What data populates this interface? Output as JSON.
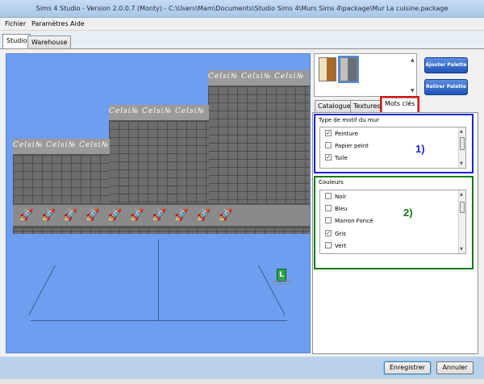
{
  "window": {
    "title": "Sims 4 Studio - Version 2.0.0.7  (Monty)   - C:\\Users\\Mam\\Documents\\Studio Sims 4\\Murs Sims 4\\package\\Mur  La cuisine.package"
  },
  "menu": {
    "items": [
      "Fichier",
      "Paramètres",
      "Aide"
    ]
  },
  "main_tabs": [
    {
      "label": "Studio",
      "active": true
    },
    {
      "label": "Warehouse",
      "active": false
    }
  ],
  "viewport": {
    "wall_signature": "Celsi№",
    "frieze_motif": "🚀",
    "lot_label": "L"
  },
  "palette": {
    "add_label": "Ajouter Palette",
    "remove_label": "Retirer Palette",
    "swatches": [
      {
        "name": "brown-swatch",
        "color": "#a76a2a"
      },
      {
        "name": "grey-swatch",
        "color": "#6a6f77",
        "selected": true
      }
    ]
  },
  "right_tabs": [
    {
      "label": "Catalogue"
    },
    {
      "label": "Textures"
    },
    {
      "label": "Mots clés",
      "active": true
    }
  ],
  "motif_group": {
    "label": "Type de motif du mur",
    "number": "1)",
    "items": [
      {
        "label": "Peinture",
        "checked": true
      },
      {
        "label": "Papier peint",
        "checked": false
      },
      {
        "label": "Tuile",
        "checked": true
      }
    ]
  },
  "color_group": {
    "label": "Couleurs",
    "number": "2)",
    "items": [
      {
        "label": "Noir",
        "checked": false
      },
      {
        "label": "Bleu",
        "checked": false
      },
      {
        "label": "Marron Foncé",
        "checked": false
      },
      {
        "label": "Gris",
        "checked": true
      },
      {
        "label": "Vert",
        "checked": false
      }
    ]
  },
  "footer": {
    "save_label": "Enregistrer",
    "cancel_label": "Annuler"
  },
  "colors": {
    "accent_blue": "#1a23d8",
    "accent_green": "#177a17",
    "accent_red": "#e01010",
    "viewport_bg": "#6e9eef"
  }
}
